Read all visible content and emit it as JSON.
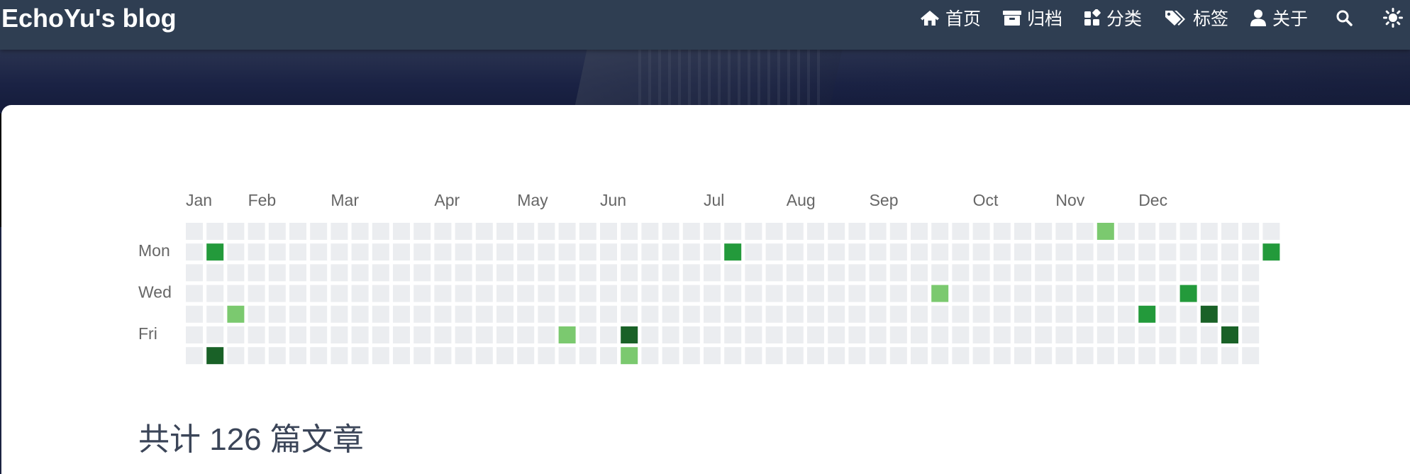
{
  "nav": {
    "brand": "EchoYu's blog",
    "items": [
      {
        "label": "首页",
        "icon": "home-icon"
      },
      {
        "label": "归档",
        "icon": "archive-icon"
      },
      {
        "label": "分类",
        "icon": "categories-icon"
      },
      {
        "label": "标签",
        "icon": "tags-icon"
      },
      {
        "label": "关于",
        "icon": "user-icon"
      }
    ],
    "search_icon": "search-icon",
    "theme_icon": "sun-icon"
  },
  "heatmap": {
    "months": [
      {
        "label": "Jan",
        "week": 0
      },
      {
        "label": "Feb",
        "week": 3
      },
      {
        "label": "Mar",
        "week": 7
      },
      {
        "label": "Apr",
        "week": 12
      },
      {
        "label": "May",
        "week": 16
      },
      {
        "label": "Jun",
        "week": 20
      },
      {
        "label": "Jul",
        "week": 25
      },
      {
        "label": "Aug",
        "week": 29
      },
      {
        "label": "Sep",
        "week": 33
      },
      {
        "label": "Oct",
        "week": 38
      },
      {
        "label": "Nov",
        "week": 42
      },
      {
        "label": "Dec",
        "week": 46
      }
    ],
    "day_labels": [
      {
        "label": "Mon",
        "row": 1
      },
      {
        "label": "Wed",
        "row": 3
      },
      {
        "label": "Fri",
        "row": 5
      }
    ],
    "weeks": 53,
    "last_week_days": 2,
    "colors": [
      "#ebedf0",
      "#7bc96f",
      "#239a3b",
      "#196127"
    ],
    "active": [
      {
        "week": 1,
        "day": 1,
        "level": 2
      },
      {
        "week": 1,
        "day": 6,
        "level": 3
      },
      {
        "week": 2,
        "day": 4,
        "level": 1
      },
      {
        "week": 18,
        "day": 5,
        "level": 1
      },
      {
        "week": 21,
        "day": 5,
        "level": 3
      },
      {
        "week": 21,
        "day": 6,
        "level": 1
      },
      {
        "week": 26,
        "day": 1,
        "level": 2
      },
      {
        "week": 36,
        "day": 3,
        "level": 1
      },
      {
        "week": 44,
        "day": 0,
        "level": 1
      },
      {
        "week": 46,
        "day": 4,
        "level": 2
      },
      {
        "week": 48,
        "day": 3,
        "level": 2
      },
      {
        "week": 49,
        "day": 4,
        "level": 3
      },
      {
        "week": 50,
        "day": 5,
        "level": 3
      },
      {
        "week": 52,
        "day": 1,
        "level": 2
      }
    ]
  },
  "heading": "共计 126 篇文章"
}
